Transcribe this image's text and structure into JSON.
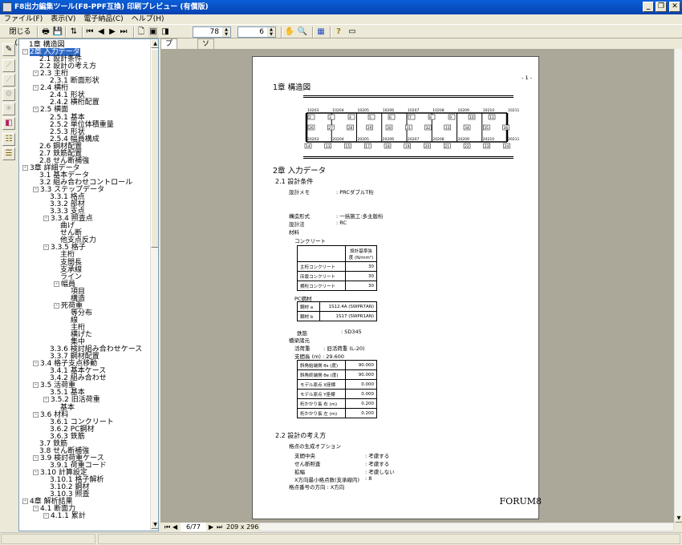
{
  "window": {
    "title": "F8出力編集ツール(F8-PPF互換) 印刷プレビュー (有償版)",
    "minimize": "_",
    "restore": "❐",
    "close": "✕"
  },
  "menu": [
    "ファイル(F)",
    "表示(V)",
    "電子納品(C)",
    "ヘルプ(H)"
  ],
  "toolbar": {
    "close_label": "閉じる(X)",
    "zoom_value": "78",
    "pages_value": "6"
  },
  "tree": [
    {
      "l": 0,
      "e": "",
      "t": "1章 構造図"
    },
    {
      "l": 0,
      "e": "-",
      "t": "2章 入力データ",
      "sel": true
    },
    {
      "l": 1,
      "e": "",
      "t": "2.1 設計条件"
    },
    {
      "l": 1,
      "e": "",
      "t": "2.2 設計の考え方"
    },
    {
      "l": 1,
      "e": "-",
      "t": "2.3 主桁"
    },
    {
      "l": 2,
      "e": "",
      "t": "2.3.1 断面形状"
    },
    {
      "l": 1,
      "e": "-",
      "t": "2.4 横桁"
    },
    {
      "l": 2,
      "e": "",
      "t": "2.4.1 形状"
    },
    {
      "l": 2,
      "e": "",
      "t": "2.4.2 横桁配置"
    },
    {
      "l": 1,
      "e": "-",
      "t": "2.5 横面"
    },
    {
      "l": 2,
      "e": "",
      "t": "2.5.1 基本"
    },
    {
      "l": 2,
      "e": "",
      "t": "2.5.2 単位体積重量"
    },
    {
      "l": 2,
      "e": "",
      "t": "2.5.3 形状"
    },
    {
      "l": 2,
      "e": "",
      "t": "2.5.4 幅員構成"
    },
    {
      "l": 1,
      "e": "",
      "t": "2.6 鋼材配置"
    },
    {
      "l": 1,
      "e": "",
      "t": "2.7 鉄筋配置"
    },
    {
      "l": 1,
      "e": "",
      "t": "2.8 せん断補強"
    },
    {
      "l": 0,
      "e": "-",
      "t": "3章 詳細データ"
    },
    {
      "l": 1,
      "e": "",
      "t": "3.1 基本データ"
    },
    {
      "l": 1,
      "e": "",
      "t": "3.2 組み合わせコントロール"
    },
    {
      "l": 1,
      "e": "-",
      "t": "3.3 ステップデータ"
    },
    {
      "l": 2,
      "e": "",
      "t": "3.3.1 格点"
    },
    {
      "l": 2,
      "e": "",
      "t": "3.3.2 部材"
    },
    {
      "l": 2,
      "e": "",
      "t": "3.3.3 支点"
    },
    {
      "l": 2,
      "e": "-",
      "t": "3.3.4 照査点"
    },
    {
      "l": 3,
      "e": "",
      "t": "曲げ"
    },
    {
      "l": 3,
      "e": "",
      "t": "せん断"
    },
    {
      "l": 3,
      "e": "",
      "t": "他支点反力"
    },
    {
      "l": 2,
      "e": "-",
      "t": "3.3.5 格子"
    },
    {
      "l": 3,
      "e": "",
      "t": "主桁"
    },
    {
      "l": 3,
      "e": "",
      "t": "支間長"
    },
    {
      "l": 3,
      "e": "",
      "t": "支承線"
    },
    {
      "l": 3,
      "e": "",
      "t": "ライン"
    },
    {
      "l": 3,
      "e": "-",
      "t": "幅員"
    },
    {
      "l": 4,
      "e": "",
      "t": "項目"
    },
    {
      "l": 4,
      "e": "",
      "t": "構造"
    },
    {
      "l": 3,
      "e": "-",
      "t": "死荷重"
    },
    {
      "l": 4,
      "e": "",
      "t": "等分布"
    },
    {
      "l": 4,
      "e": "",
      "t": "線"
    },
    {
      "l": 4,
      "e": "",
      "t": "主桁"
    },
    {
      "l": 4,
      "e": "",
      "t": "横げた"
    },
    {
      "l": 4,
      "e": "",
      "t": "集中"
    },
    {
      "l": 2,
      "e": "",
      "t": "3.3.6 検討組み合わせケース"
    },
    {
      "l": 2,
      "e": "",
      "t": "3.3.7 鋼材配置"
    },
    {
      "l": 1,
      "e": "-",
      "t": "3.4 格子支点移動"
    },
    {
      "l": 2,
      "e": "",
      "t": "3.4.1 基本ケース"
    },
    {
      "l": 2,
      "e": "",
      "t": "3.4.2 組み合わせ"
    },
    {
      "l": 1,
      "e": "-",
      "t": "3.5 活荷重"
    },
    {
      "l": 2,
      "e": "",
      "t": "3.5.1 基本"
    },
    {
      "l": 2,
      "e": "-",
      "t": "3.5.2 旧活荷重"
    },
    {
      "l": 3,
      "e": "",
      "t": "基本"
    },
    {
      "l": 1,
      "e": "-",
      "t": "3.6 材料"
    },
    {
      "l": 2,
      "e": "",
      "t": "3.6.1 コンクリート"
    },
    {
      "l": 2,
      "e": "",
      "t": "3.6.2 PC鋼材"
    },
    {
      "l": 2,
      "e": "",
      "t": "3.6.3 鉄筋"
    },
    {
      "l": 1,
      "e": "",
      "t": "3.7 鉄筋"
    },
    {
      "l": 1,
      "e": "",
      "t": "3.8 せん断補強"
    },
    {
      "l": 1,
      "e": "-",
      "t": "3.9 検討荷重ケース"
    },
    {
      "l": 2,
      "e": "",
      "t": "3.9.1 荷重コード"
    },
    {
      "l": 1,
      "e": "-",
      "t": "3.10 計算設定"
    },
    {
      "l": 2,
      "e": "",
      "t": "3.10.1 格子解析"
    },
    {
      "l": 2,
      "e": "",
      "t": "3.10.2 鋼材"
    },
    {
      "l": 2,
      "e": "",
      "t": "3.10.3 照査"
    },
    {
      "l": 0,
      "e": "-",
      "t": "4章 解析結果"
    },
    {
      "l": 1,
      "e": "-",
      "t": "4.1 断面力"
    },
    {
      "l": 2,
      "e": "-",
      "t": "4.1.1 累計"
    }
  ],
  "tabs": [
    "プレビュー",
    "ソース"
  ],
  "page": {
    "page_number": "- 1 -",
    "ch1": "1章 構造図",
    "diagram": {
      "top_nodes": [
        "10203",
        "10204",
        "10205",
        "10206",
        "10207",
        "10208",
        "10209",
        "10210",
        "10211"
      ],
      "bottom_nodes": [
        "20203",
        "20204",
        "20205",
        "20206",
        "20207",
        "20208",
        "20209",
        "20210",
        "20211"
      ],
      "top_elems": [
        "2",
        "3",
        "4",
        "5",
        "6",
        "7",
        "8",
        "9",
        "10",
        "11"
      ],
      "mid_elems": [
        "26",
        "27",
        "28",
        "29",
        "30",
        "31",
        "32",
        "33",
        "34",
        "35",
        "36"
      ],
      "bot_elems": [
        "14",
        "13",
        "15",
        "17",
        "18",
        "19",
        "20",
        "21",
        "22",
        "23",
        "24"
      ]
    },
    "ch2": "2章 入力データ",
    "s21": "2.1 設計条件",
    "memo_label": "設計メモ",
    "memo_value": ": PRCダブルT桁",
    "form_label": "構造形式",
    "form_value": ": 一括施工:多主版桁",
    "method_label": "設計法",
    "method_value": ": RC",
    "material": "材料",
    "concrete": "コンクリート",
    "conc_header": "設計基準強度 (N/mm²)",
    "conc_rows": [
      [
        "主桁コンクリート",
        "30"
      ],
      [
        "床版コンクリート",
        "30"
      ],
      [
        "横桁コンクリート",
        "30"
      ]
    ],
    "pc": "PC鋼材",
    "pc_rows": [
      [
        "鋼材 a",
        "1S12.4A (SWPR7AN)"
      ],
      [
        "鋼材 b",
        "1S17 (SWPR1AN)"
      ]
    ],
    "rebar_label": "鉄筋",
    "rebar_value": ": SD345",
    "spec": "橋梁諸元",
    "live_label": "活荷重",
    "live_value": ": 旧活荷重 (L-20)",
    "span_label": "支間長 (m) : 29.600",
    "spec_rows": [
      [
        "斜角始端側 θs (度)",
        "90.000"
      ],
      [
        "斜角終端側 θe (度)",
        "90.000"
      ],
      [
        "モデル原点 X座標",
        "0.000"
      ],
      [
        "モデル原点 Y座標",
        "0.000"
      ],
      [
        "桁かかり長 右 (m)",
        "0.200"
      ],
      [
        "桁かかり長 左 (m)",
        "0.200"
      ]
    ],
    "s22": "2.2 設計の考え方",
    "opt": "格点の生成オプション",
    "opts": [
      [
        "支間中央",
        ": 考慮する"
      ],
      [
        "せん断照査",
        ": 考慮する"
      ],
      [
        "拡幅",
        ": 考慮しない"
      ],
      [
        "X方向最小格点数(支承線内)",
        ": 8"
      ]
    ],
    "dir": "格点番号の方向 : X方向",
    "logo": "FORUM8"
  },
  "nav": {
    "page": "6/77",
    "size": "209 x 296mm"
  }
}
